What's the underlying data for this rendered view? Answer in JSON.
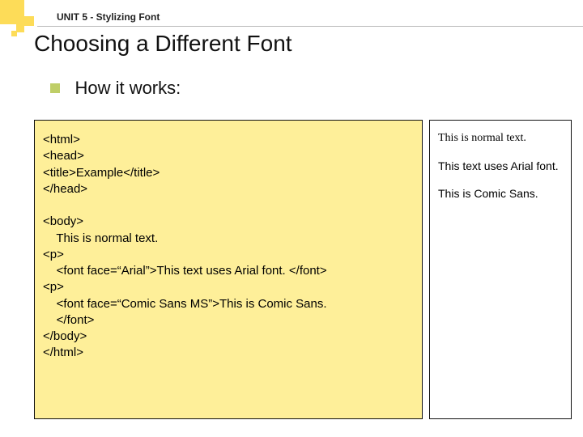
{
  "unit": "UNIT 5 - Stylizing Font",
  "title": "Choosing a Different Font",
  "bullet": "How it works:",
  "code": {
    "l1": "<html>",
    "l2": "<head>",
    "l3": "<title>Example</title>",
    "l4": "</head>",
    "l5": "<body>",
    "l6": "    This is normal text.",
    "l7": "<p>",
    "l8": "    <font face=“Arial”>This text uses Arial font. </font>",
    "l9": "<p>",
    "l10": "    <font face=“Comic Sans MS”>This is Comic Sans.",
    "l11": "    </font>",
    "l12": "</body>",
    "l13": "</html>"
  },
  "preview": {
    "p1": "This is normal text.",
    "p2": "This text uses Arial font.",
    "p3": "This is Comic Sans."
  }
}
